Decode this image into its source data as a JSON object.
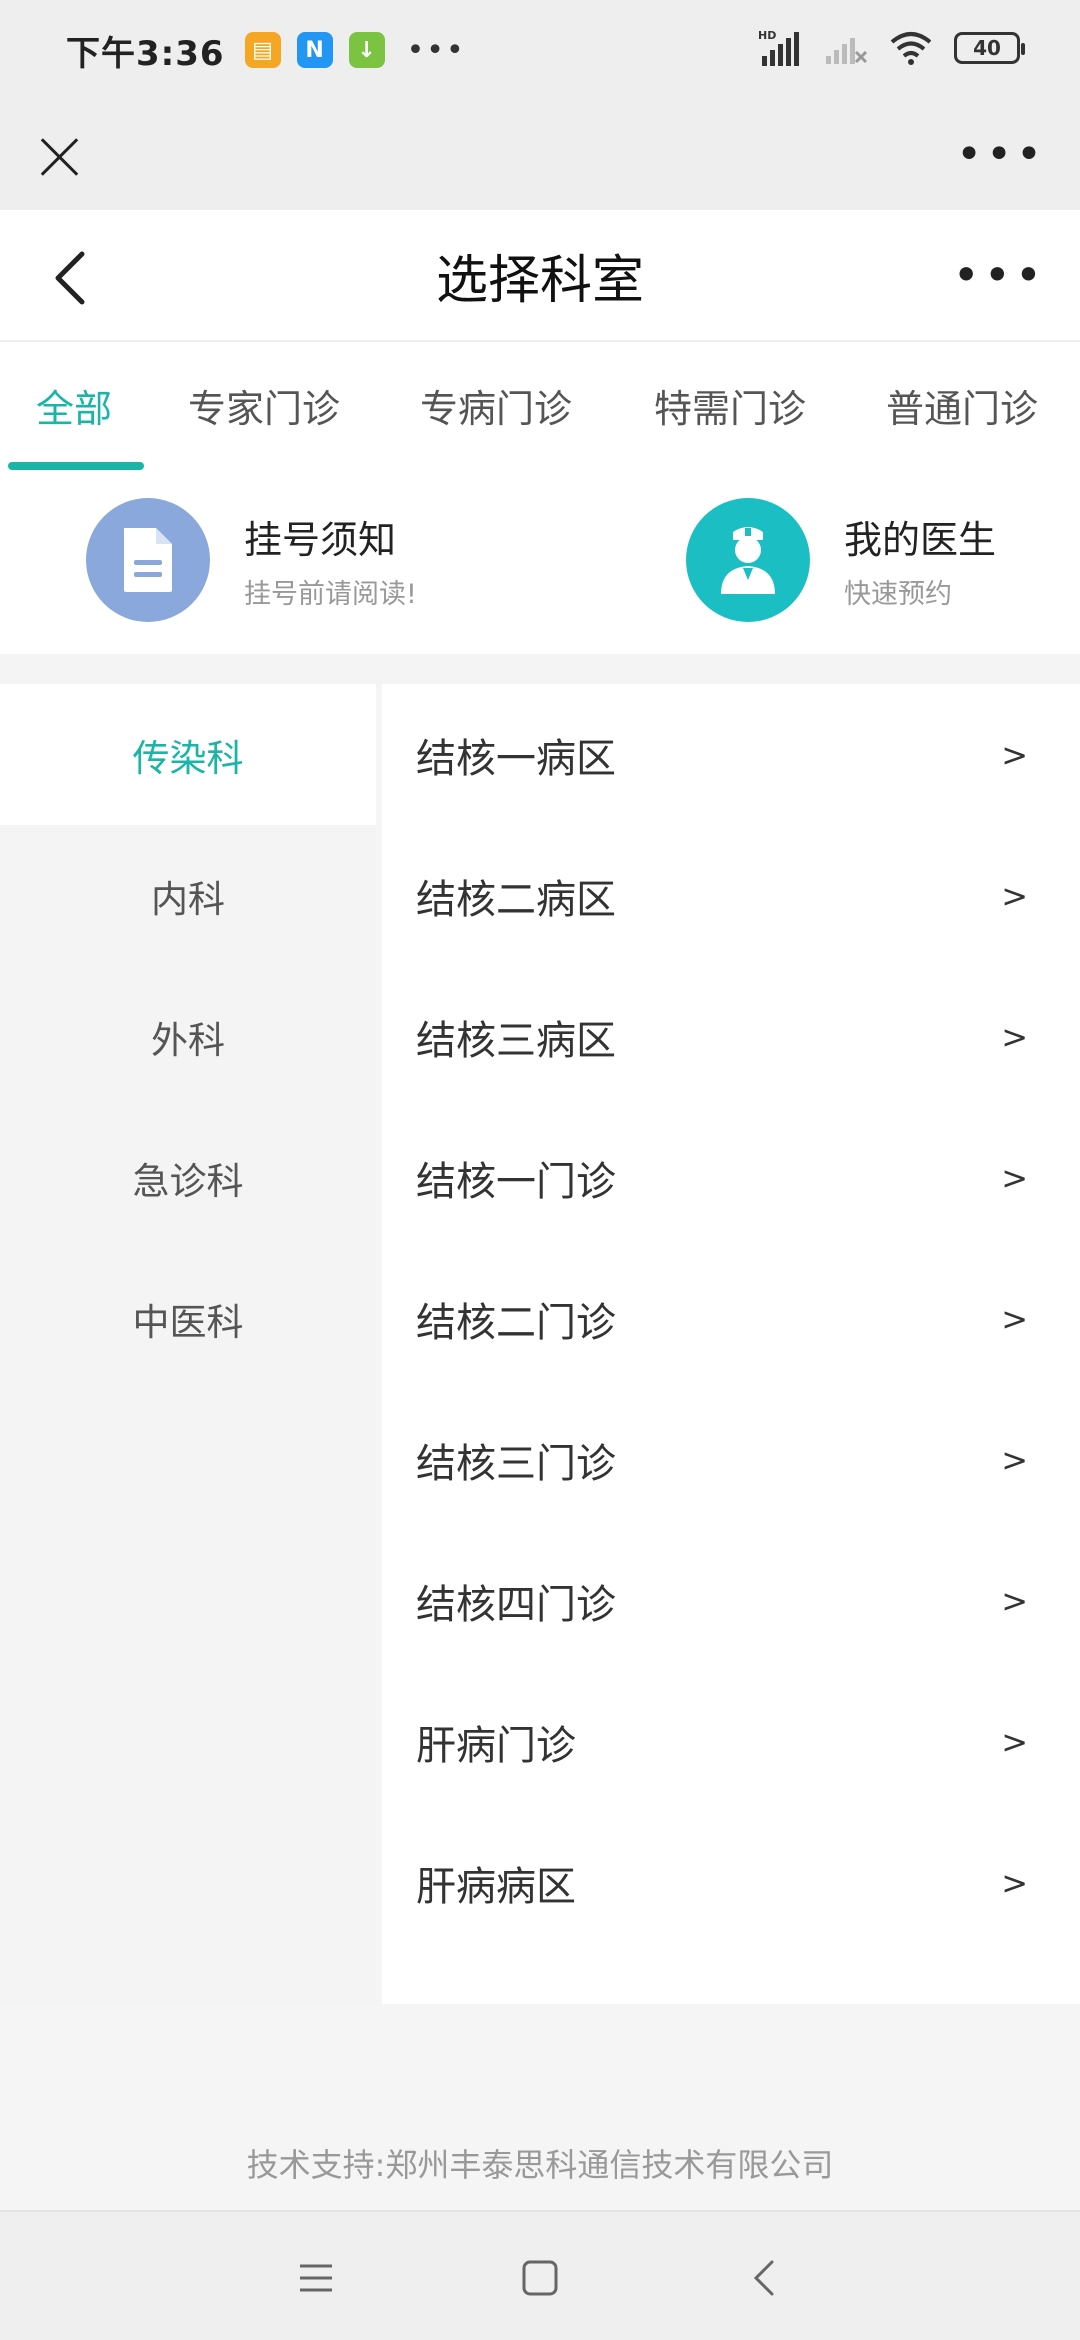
{
  "status_bar": {
    "time": "下午3:36",
    "app_icons": [
      "notes-app-icon",
      "n-app-icon",
      "download-app-icon"
    ],
    "overflow": "•••",
    "battery": "40"
  },
  "webview": {
    "more_label": "•••"
  },
  "nav": {
    "title": "选择科室",
    "more_label": "•••"
  },
  "tabs": [
    {
      "label": "全部",
      "active": true
    },
    {
      "label": "专家门诊"
    },
    {
      "label": "专病门诊"
    },
    {
      "label": "特需门诊"
    },
    {
      "label": "普通门诊"
    }
  ],
  "info": {
    "notice": {
      "title": "挂号须知",
      "subtitle": "挂号前请阅读!"
    },
    "my_doctor": {
      "title": "我的医生",
      "subtitle": "快速预约"
    }
  },
  "departments": [
    {
      "label": "传染科",
      "active": true
    },
    {
      "label": "内科"
    },
    {
      "label": "外科"
    },
    {
      "label": "急诊科"
    },
    {
      "label": "中医科"
    }
  ],
  "wards": [
    {
      "label": "结核一病区",
      "arrow": ">"
    },
    {
      "label": "结核二病区",
      "arrow": ">"
    },
    {
      "label": "结核三病区",
      "arrow": ">"
    },
    {
      "label": "结核一门诊",
      "arrow": ">"
    },
    {
      "label": "结核二门诊",
      "arrow": ">"
    },
    {
      "label": "结核三门诊",
      "arrow": ">"
    },
    {
      "label": "结核四门诊",
      "arrow": ">"
    },
    {
      "label": "肝病门诊",
      "arrow": ">"
    },
    {
      "label": "肝病病区",
      "arrow": ">"
    }
  ],
  "footer": "技术支持:郑州丰泰思科通信技术有限公司",
  "colors": {
    "accent": "#1bb5a8",
    "notice_icon_bg": "#8aa8dc",
    "doctor_icon_bg": "#1bbfc3"
  }
}
